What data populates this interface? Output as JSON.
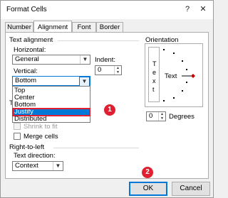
{
  "window": {
    "title": "Format Cells",
    "help_glyph": "?",
    "close_glyph": "✕"
  },
  "tabs": [
    {
      "label": "Number"
    },
    {
      "label": "Alignment"
    },
    {
      "label": "Font"
    },
    {
      "label": "Border"
    }
  ],
  "text_alignment": {
    "group_title": "Text alignment",
    "horizontal_label": "Horizontal:",
    "horizontal_value": "General",
    "indent_label": "Indent:",
    "indent_value": "0",
    "vertical_label": "Vertical:",
    "vertical_value": "Bottom",
    "vertical_options": [
      "Top",
      "Center",
      "Bottom",
      "Justify",
      "Distributed"
    ],
    "selected_option": "Justify"
  },
  "text_control": {
    "group_title_partial": "T",
    "shrink_label": "Shrink to fit",
    "merge_label": "Merge cells"
  },
  "right_to_left": {
    "group_title": "Right-to-left",
    "direction_label": "Text direction:",
    "direction_value": "Context"
  },
  "orientation": {
    "group_title": "Orientation",
    "vertical_text_chars": [
      "T",
      "e",
      "x",
      "t"
    ],
    "dial_label": "Text",
    "degrees_value": "0",
    "degrees_label": "Degrees"
  },
  "buttons": {
    "ok": "OK",
    "cancel": "Cancel"
  },
  "callouts": {
    "step1": "1",
    "step2": "2"
  },
  "colors": {
    "accent": "#0078d7",
    "callout": "#e02030"
  }
}
